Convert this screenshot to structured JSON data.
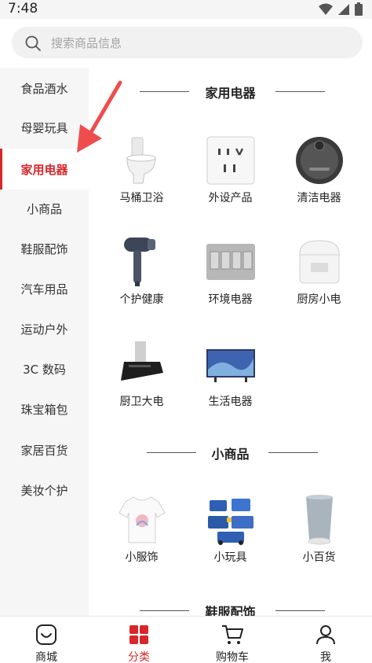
{
  "status": {
    "time": "7:48"
  },
  "search": {
    "placeholder": "搜索商品信息"
  },
  "sidebar": {
    "items": [
      {
        "label": "食品酒水",
        "active": false
      },
      {
        "label": "母婴玩具",
        "active": false
      },
      {
        "label": "家用电器",
        "active": true
      },
      {
        "label": "小商品",
        "active": false
      },
      {
        "label": "鞋服配饰",
        "active": false
      },
      {
        "label": "汽车用品",
        "active": false
      },
      {
        "label": "运动户外",
        "active": false
      },
      {
        "label": "3C 数码",
        "active": false
      },
      {
        "label": "珠宝箱包",
        "active": false
      },
      {
        "label": "家居百货",
        "active": false
      },
      {
        "label": "美妆个护",
        "active": false
      }
    ]
  },
  "sections": [
    {
      "title": "家用电器",
      "items": [
        {
          "label": "马桶卫浴",
          "icon": "toilet-icon"
        },
        {
          "label": "外设产品",
          "icon": "power-socket-icon"
        },
        {
          "label": "清洁电器",
          "icon": "robot-vacuum-icon"
        },
        {
          "label": "个护健康",
          "icon": "hair-dryer-icon"
        },
        {
          "label": "环境电器",
          "icon": "switch-panel-icon"
        },
        {
          "label": "厨房小电",
          "icon": "rice-cooker-icon"
        },
        {
          "label": "厨卫大电",
          "icon": "range-hood-icon"
        },
        {
          "label": "生活电器",
          "icon": "television-icon"
        }
      ]
    },
    {
      "title": "小商品",
      "items": [
        {
          "label": "小服饰",
          "icon": "tshirt-icon"
        },
        {
          "label": "小玩具",
          "icon": "toy-blocks-icon"
        },
        {
          "label": "小百货",
          "icon": "cup-icon"
        }
      ]
    },
    {
      "title": "鞋服配饰",
      "items": []
    }
  ],
  "tabbar": {
    "tabs": [
      {
        "label": "商城",
        "icon": "shop-icon",
        "active": false
      },
      {
        "label": "分类",
        "icon": "category-grid-icon",
        "active": true
      },
      {
        "label": "购物车",
        "icon": "cart-icon",
        "active": false
      },
      {
        "label": "我",
        "icon": "user-icon",
        "active": false
      }
    ]
  },
  "colors": {
    "accent": "#d8262a",
    "sidebar_bg": "#f6f6f6",
    "search_bg": "#f1f1f1"
  }
}
